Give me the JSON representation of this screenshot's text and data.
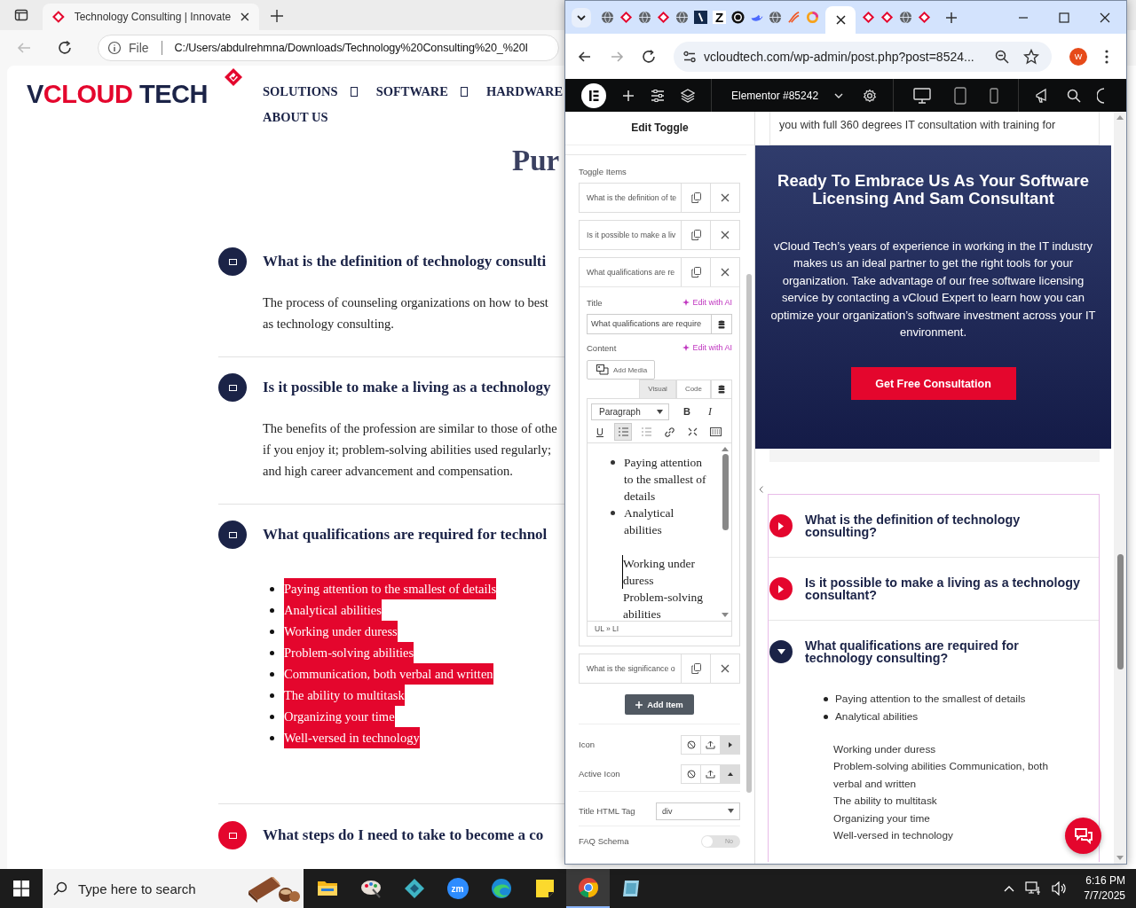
{
  "edge": {
    "tab": {
      "title": "Technology Consulting | Innovate",
      "selected": true
    },
    "address": {
      "scheme": "File",
      "url": "C:/Users/abdulrehmna/Downloads/Technology%20Consulting%20_%20I"
    },
    "page": {
      "logo": {
        "first": "V",
        "accent": "CLOUD",
        "last": " TECH"
      },
      "nav": [
        {
          "label": "SOLUTIONS",
          "dropdown": true
        },
        {
          "label": "SOFTWARE",
          "dropdown": true
        },
        {
          "label": "HARDWARE",
          "dropdown": false
        },
        {
          "label": "ABOUT US",
          "dropdown": false
        }
      ],
      "heading": "Pur",
      "faq": [
        {
          "kind": "text",
          "title": "What is the definition of technology consulti",
          "color": "#1b2347",
          "lines": [
            "The process of counseling organizations on how to best",
            "as technology consulting."
          ]
        },
        {
          "kind": "text",
          "title": "Is it possible to make a living as a technology",
          "color": "#1b2347",
          "lines": [
            "The benefits of the profession are similar to those of othe",
            "if you enjoy it; problem-solving abilities used regularly;",
            "and high career advancement and compensation."
          ]
        },
        {
          "kind": "list",
          "title": "What qualifications are required for technol",
          "color": "#1b2347",
          "items": [
            "Paying attention to the smallest of details",
            "Analytical abilities",
            "Working under duress",
            "Problem-solving abilities",
            "Communication, both verbal and written",
            "The ability to multitask",
            "Organizing your time",
            "Well-versed in technology"
          ]
        },
        {
          "kind": "closed",
          "title": "What steps do I need to take to become a co",
          "color": "#e4062d"
        }
      ]
    }
  },
  "chrome": {
    "tabs": [
      {
        "kind": "globe",
        "selected": false
      },
      {
        "kind": "brand",
        "selected": false
      },
      {
        "kind": "globe",
        "selected": false
      },
      {
        "kind": "brand",
        "selected": false
      },
      {
        "kind": "globe",
        "selected": false
      },
      {
        "kind": "slash",
        "selected": false
      },
      {
        "kind": "letter",
        "label": "Z",
        "selected": false
      },
      {
        "kind": "dark",
        "selected": false
      },
      {
        "kind": "whale",
        "selected": false
      },
      {
        "kind": "globe",
        "selected": false
      },
      {
        "kind": "swirl",
        "selected": false
      },
      {
        "kind": "ring",
        "selected": false
      },
      {
        "kind": "active",
        "selected": true
      },
      {
        "kind": "brand",
        "selected": false
      },
      {
        "kind": "brand",
        "selected": false
      },
      {
        "kind": "globe",
        "selected": false
      },
      {
        "kind": "brand",
        "selected": false
      }
    ],
    "address": "vcloudtech.com/wp-admin/post.php?post=8524...",
    "profile": "W"
  },
  "elementor": {
    "document": "Elementor #85242",
    "devices": [
      {
        "kind": "desktop"
      },
      {
        "kind": "tablet"
      },
      {
        "kind": "mobile"
      }
    ]
  },
  "panel": {
    "title": "Edit Toggle",
    "section_label": "Toggle Items",
    "items": [
      {
        "title": "What is the definition of te",
        "expanded": false
      },
      {
        "title": "Is it possible to make a liv",
        "expanded": false
      },
      {
        "title": "What qualifications are re",
        "expanded": true
      },
      {
        "title": "What is the significance o",
        "expanded": false
      }
    ],
    "editor": {
      "title_label": "Title",
      "title_ai": "Edit with AI",
      "title_value": "What qualifications are require",
      "content_label": "Content",
      "content_ai": "Edit with AI",
      "add_media": "Add Media",
      "modes": [
        {
          "label": "Visual",
          "selected": true
        },
        {
          "label": "Code",
          "selected": false
        }
      ],
      "format": "Paragraph",
      "tools": [
        {
          "kind": "bold",
          "label": "B",
          "selected": false
        },
        {
          "kind": "italic",
          "label": "I",
          "selected": false
        },
        {
          "kind": "underline",
          "label": "U",
          "selected": false
        },
        {
          "kind": "bullets",
          "selected": true
        },
        {
          "kind": "numbers",
          "selected": false
        },
        {
          "kind": "link",
          "selected": false
        },
        {
          "kind": "fullscreen",
          "selected": false
        },
        {
          "kind": "toolbar",
          "selected": false
        }
      ],
      "bullets": [
        "Paying attention to the smallest of details",
        "Analytical abilities"
      ],
      "lines": [
        "Working under duress",
        "Problem-solving abilities"
      ],
      "path": "UL » LI"
    },
    "add_item": "Add Item",
    "settings": [
      {
        "kind": "icon",
        "label": "Icon"
      },
      {
        "kind": "active-icon",
        "label": "Active Icon"
      },
      {
        "kind": "select",
        "label": "Title HTML Tag",
        "value": "div"
      },
      {
        "kind": "switch",
        "label": "FAQ Schema",
        "on": false,
        "state_label": "No"
      }
    ]
  },
  "preview": {
    "intro": "you with full 360 degrees IT consultation with training for",
    "cta": {
      "heading": "Ready To Embrace Us As Your Software Licensing And Sam Consultant",
      "body": "vCloud Tech’s years of experience in working in the IT industry makes us an ideal partner to get the right tools for your organization. Take advantage of our free software licensing service by contacting a vCloud Expert to learn how you can optimize your organization’s software investment across your IT environment.",
      "button": "Get Free Consultation"
    },
    "accordion": [
      {
        "title": "What is the definition of technology consulting?",
        "expanded": false
      },
      {
        "title": "Is it possible to make a living as a technology consultant?",
        "expanded": false
      },
      {
        "title": "What qualifications are required for technology consulting?",
        "expanded": true,
        "bullets": [
          "Paying attention to the smallest of details",
          "Analytical abilities"
        ],
        "lines": [
          "Working under duress",
          "Problem-solving abilities Communication, both verbal and written",
          "The ability to multitask",
          "Organizing your time",
          "Well-versed in technology"
        ]
      }
    ]
  },
  "taskbar": {
    "search_placeholder": "Type here to search",
    "apps": [
      {
        "kind": "folder",
        "selected": false
      },
      {
        "kind": "paint",
        "selected": false
      },
      {
        "kind": "gem",
        "selected": false
      },
      {
        "kind": "zoom",
        "label": "zm",
        "selected": false
      },
      {
        "kind": "edge",
        "selected": false
      },
      {
        "kind": "notes",
        "selected": false
      },
      {
        "kind": "chrome",
        "selected": true
      },
      {
        "kind": "app",
        "selected": false
      }
    ],
    "time": "6:16 PM",
    "date": "7/7/2025"
  }
}
